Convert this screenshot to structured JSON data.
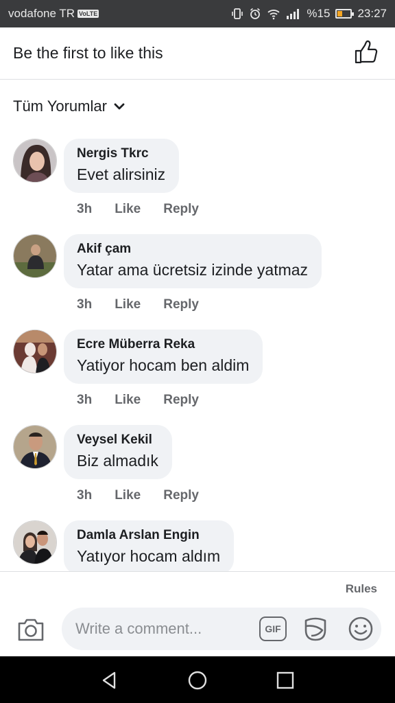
{
  "status_bar": {
    "carrier": "vodafone TR",
    "volte": "VoLTE",
    "battery": "%15",
    "time": "23:27",
    "battery_level": 0.15
  },
  "header": {
    "likes_text": "Be the first to like this",
    "like_icon": "thumbs-up-outline-icon"
  },
  "filter": {
    "label": "Tüm Yorumlar",
    "icon": "chevron-down-icon"
  },
  "comments": [
    {
      "author": "Nergis Tkrc",
      "text": "Evet alirsiniz",
      "time": "3h",
      "like": "Like",
      "reply": "Reply"
    },
    {
      "author": "Akif çam",
      "text": "Yatar ama ücretsiz izinde yatmaz",
      "time": "3h",
      "like": "Like",
      "reply": "Reply"
    },
    {
      "author": "Ecre Müberra Reka",
      "text": "Yatiyor hocam ben aldim",
      "time": "3h",
      "like": "Like",
      "reply": "Reply"
    },
    {
      "author": "Veysel Kekil",
      "text": "Biz almadık",
      "time": "3h",
      "like": "Like",
      "reply": "Reply"
    },
    {
      "author": "Damla Arslan Engin",
      "text": "Yatıyor hocam aldım",
      "time": "",
      "like": "",
      "reply": ""
    }
  ],
  "composer": {
    "rules": "Rules",
    "placeholder": "Write a comment...",
    "gif_label": "GIF",
    "icons": [
      "camera-icon",
      "gif-icon",
      "sticker-icon",
      "emoji-icon"
    ]
  },
  "nav": {
    "icons": [
      "back-icon",
      "home-icon",
      "recents-icon"
    ]
  },
  "colors": {
    "status_bar": "#3a3b3d",
    "bubble": "#f0f2f5",
    "secondary_text": "#65676b",
    "nav_bar": "#000000"
  }
}
